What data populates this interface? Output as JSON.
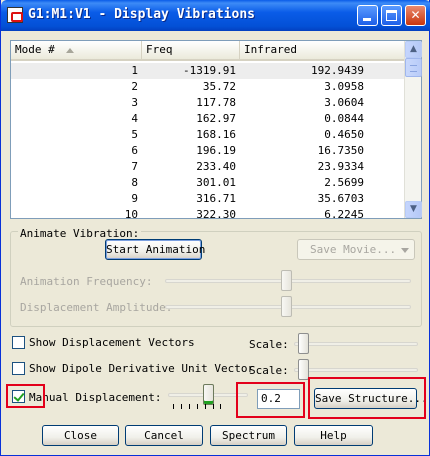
{
  "window": {
    "title": "G1:M1:V1 - Display Vibrations",
    "min_icon": "minimize-icon",
    "max_icon": "maximize-icon",
    "close_label": "✕"
  },
  "table": {
    "columns": [
      "Mode #",
      "Freq",
      "Infrared"
    ],
    "rows": [
      {
        "mode": "1",
        "freq": "-1319.91",
        "ir": "192.9439"
      },
      {
        "mode": "2",
        "freq": "35.72",
        "ir": "3.0958"
      },
      {
        "mode": "3",
        "freq": "117.78",
        "ir": "3.0604"
      },
      {
        "mode": "4",
        "freq": "162.97",
        "ir": "0.0844"
      },
      {
        "mode": "5",
        "freq": "168.16",
        "ir": "0.4650"
      },
      {
        "mode": "6",
        "freq": "196.19",
        "ir": "16.7350"
      },
      {
        "mode": "7",
        "freq": "233.40",
        "ir": "23.9334"
      },
      {
        "mode": "8",
        "freq": "301.01",
        "ir": "2.5699"
      },
      {
        "mode": "9",
        "freq": "316.71",
        "ir": "35.6703"
      },
      {
        "mode": "10",
        "freq": "322.30",
        "ir": "6.2245"
      }
    ]
  },
  "animate": {
    "group_label": "Animate Vibration:",
    "start_button": "Start Animation",
    "save_movie": "Save Movie...",
    "frequency_label": "Animation Frequency:",
    "amplitude_label": "Displacement Amplitude:"
  },
  "options": {
    "show_vectors_label": "Show Displacement Vectors",
    "show_dipole_label": "Show Dipole Derivative Unit Vector",
    "scale_label": "Scale:",
    "manual_label": "Manual Displacement:",
    "manual_checked": true,
    "manual_value": "0.2",
    "save_structure": "Save Structure..."
  },
  "buttons": {
    "close": "Close",
    "cancel": "Cancel",
    "spectrum": "Spectrum",
    "help": "Help"
  },
  "colors": {
    "titlebar": "#0a5ce8",
    "highlight": "#e3001b",
    "check": "#21a121"
  }
}
